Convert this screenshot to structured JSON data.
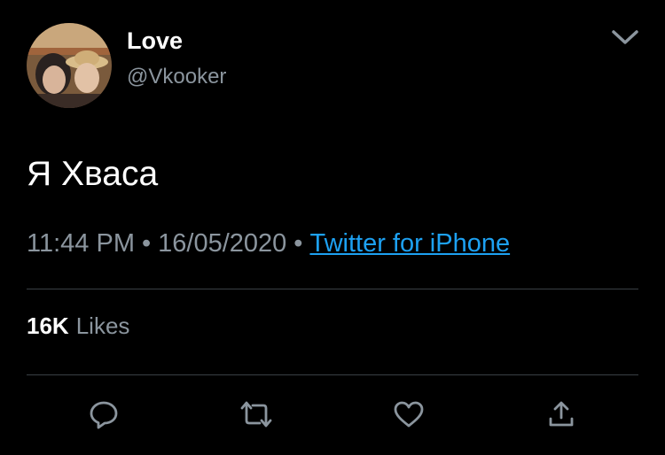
{
  "user": {
    "display_name": "Love",
    "handle": "@Vkooker"
  },
  "tweet": {
    "text": "Я Хваса",
    "time": "11:44 PM",
    "date": "16/05/2020",
    "separator": "•",
    "source": "Twitter for iPhone"
  },
  "stats": {
    "likes_count": "16K",
    "likes_label": "Likes"
  },
  "icons": {
    "menu": "chevron-down-icon",
    "reply": "reply-icon",
    "retweet": "retweet-icon",
    "like": "heart-icon",
    "share": "share-icon"
  },
  "colors": {
    "background": "#000000",
    "text_primary": "#ffffff",
    "text_secondary": "#8b959e",
    "link": "#1da1f2",
    "divider": "#3a3f45"
  }
}
